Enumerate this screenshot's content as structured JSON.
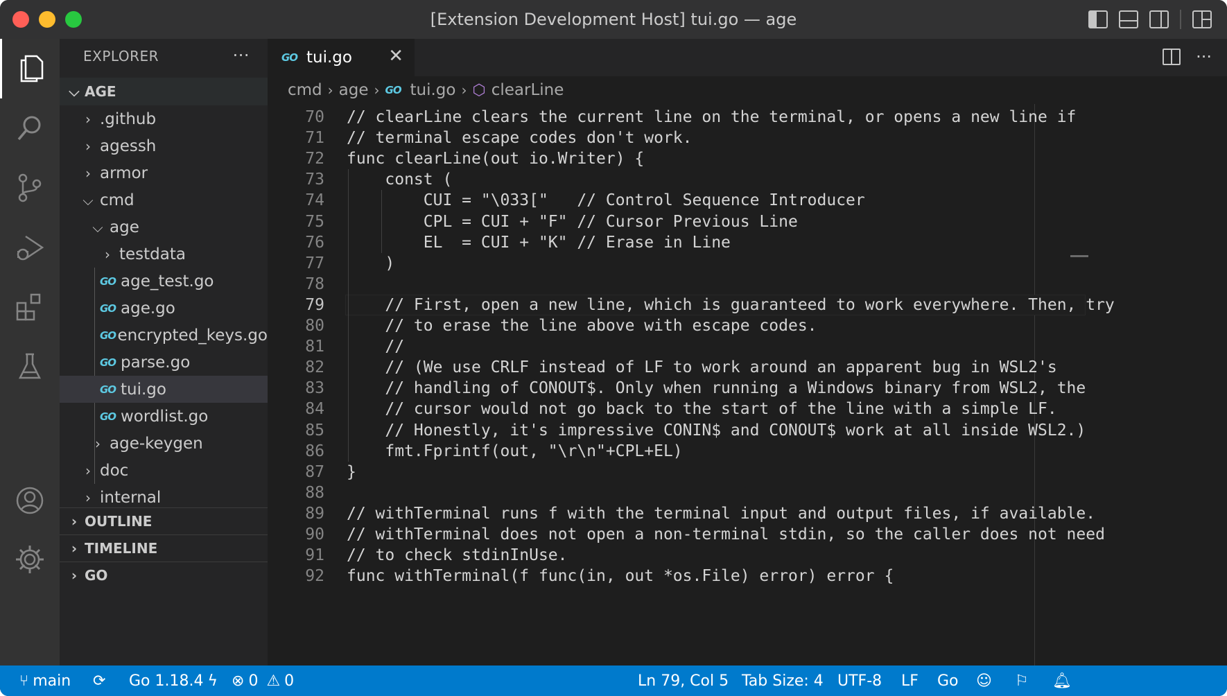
{
  "window": {
    "title": "[Extension Development Host] tui.go — age"
  },
  "sidebar": {
    "header": "EXPLORER",
    "more": "···",
    "root": "AGE",
    "tree": [
      {
        "label": ".github",
        "type": "folder",
        "expanded": false
      },
      {
        "label": "agessh",
        "type": "folder",
        "expanded": false
      },
      {
        "label": "armor",
        "type": "folder",
        "expanded": false
      },
      {
        "label": "cmd",
        "type": "folder",
        "expanded": true
      },
      {
        "label": "age",
        "type": "folder",
        "expanded": true
      },
      {
        "label": "testdata",
        "type": "folder",
        "expanded": false
      },
      {
        "label": "age_test.go",
        "type": "go-file"
      },
      {
        "label": "age.go",
        "type": "go-file"
      },
      {
        "label": "encrypted_keys.go",
        "type": "go-file"
      },
      {
        "label": "parse.go",
        "type": "go-file"
      },
      {
        "label": "tui.go",
        "type": "go-file",
        "selected": true
      },
      {
        "label": "wordlist.go",
        "type": "go-file"
      },
      {
        "label": "age-keygen",
        "type": "folder",
        "expanded": false
      },
      {
        "label": "doc",
        "type": "folder",
        "expanded": false
      },
      {
        "label": "internal",
        "type": "folder",
        "expanded": false
      }
    ],
    "sections": [
      "OUTLINE",
      "TIMELINE",
      "GO"
    ]
  },
  "editor": {
    "tab": {
      "label": "tui.go",
      "icon": "GO"
    },
    "breadcrumb": [
      "cmd",
      "age",
      "tui.go",
      "clearLine"
    ],
    "current_line": 79,
    "lines": [
      {
        "n": "70",
        "t": "// clearLine clears the current line on the terminal, or opens a new line if"
      },
      {
        "n": "71",
        "t": "// terminal escape codes don't work."
      },
      {
        "n": "72",
        "t": "func clearLine(out io.Writer) {"
      },
      {
        "n": "73",
        "t": "    const ("
      },
      {
        "n": "74",
        "t": "        CUI = \"\\033[\"   // Control Sequence Introducer"
      },
      {
        "n": "75",
        "t": "        CPL = CUI + \"F\" // Cursor Previous Line"
      },
      {
        "n": "76",
        "t": "        EL  = CUI + \"K\" // Erase in Line"
      },
      {
        "n": "77",
        "t": "    )"
      },
      {
        "n": "78",
        "t": ""
      },
      {
        "n": "79",
        "t": "    // First, open a new line, which is guaranteed to work everywhere. Then, try"
      },
      {
        "n": "80",
        "t": "    // to erase the line above with escape codes."
      },
      {
        "n": "81",
        "t": "    //"
      },
      {
        "n": "82",
        "t": "    // (We use CRLF instead of LF to work around an apparent bug in WSL2's"
      },
      {
        "n": "83",
        "t": "    // handling of CONOUT$. Only when running a Windows binary from WSL2, the"
      },
      {
        "n": "84",
        "t": "    // cursor would not go back to the start of the line with a simple LF."
      },
      {
        "n": "85",
        "t": "    // Honestly, it's impressive CONIN$ and CONOUT$ work at all inside WSL2.)"
      },
      {
        "n": "86",
        "t": "    fmt.Fprintf(out, \"\\r\\n\"+CPL+EL)"
      },
      {
        "n": "87",
        "t": "}"
      },
      {
        "n": "88",
        "t": ""
      },
      {
        "n": "89",
        "t": "// withTerminal runs f with the terminal input and output files, if available."
      },
      {
        "n": "90",
        "t": "// withTerminal does not open a non-terminal stdin, so the caller does not need"
      },
      {
        "n": "91",
        "t": "// to check stdinInUse."
      },
      {
        "n": "92",
        "t": "func withTerminal(f func(in, out *os.File) error) error {"
      }
    ]
  },
  "statusbar": {
    "branch": "main",
    "go_version": "Go 1.18.4",
    "errors": "0",
    "warnings": "0",
    "position": "Ln 79, Col 5",
    "tab_size": "Tab Size: 4",
    "encoding": "UTF-8",
    "eol": "LF",
    "language": "Go"
  },
  "colors": {
    "statusbar": "#007acc",
    "activitybar": "#333333",
    "sidebar": "#252526",
    "editor": "#1e1e1e",
    "go_icon": "#5dc9e2"
  }
}
